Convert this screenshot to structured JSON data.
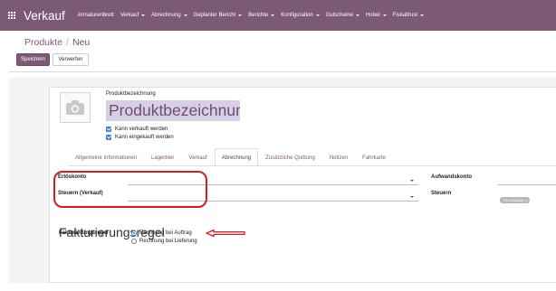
{
  "navbar": {
    "brand": "Verkauf",
    "menu": [
      {
        "label": "Armaturenbrett",
        "dropdown": false
      },
      {
        "label": "Verkauf",
        "dropdown": true
      },
      {
        "label": "Abrechnung",
        "dropdown": true
      },
      {
        "label": "Geplanter Bericht",
        "dropdown": true
      },
      {
        "label": "Berichte",
        "dropdown": true
      },
      {
        "label": "Konfiguration",
        "dropdown": true
      },
      {
        "label": "Gutscheine",
        "dropdown": true
      },
      {
        "label": "Hobel",
        "dropdown": true
      },
      {
        "label": "Fiskaltrust",
        "dropdown": true
      }
    ],
    "color": "#7c5a77"
  },
  "breadcrumb": {
    "parent": "Produkte",
    "separator": "/",
    "current": "Neu"
  },
  "buttons": {
    "save": "Speichern",
    "discard": "Verwerfen"
  },
  "product": {
    "name_label": "Produktbezeichnung",
    "name_placeholder": "Produktbezeichnung",
    "can_be_sold": "Kann verkauft werden",
    "can_be_purchased": "Kann eingekauft werden",
    "avatar_icon": "camera-icon"
  },
  "tabs": [
    {
      "label": "Allgemeine Informationen",
      "active": false
    },
    {
      "label": "Lagerbier",
      "active": false
    },
    {
      "label": "Verkauf",
      "active": false
    },
    {
      "label": "Abrechnung",
      "active": true
    },
    {
      "label": "Zusätzliche Quittung",
      "active": false
    },
    {
      "label": "Notizen",
      "active": false
    },
    {
      "label": "Fahrkarte",
      "active": false
    }
  ],
  "accounting": {
    "income_account_label": "Erlöskonto",
    "customer_taxes_label": "Steuern (Verkauf)",
    "expense_account_label": "Aufwandskonto",
    "vendor_taxes_label": "Steuern",
    "vendor_tax_tag": "7% Vorsteuer ×"
  },
  "invoicing": {
    "section_title": "Fakturierungsregel",
    "policy_label": "Fakturierungsregel",
    "options": [
      {
        "label": "Rechnung bei Auftrag",
        "checked": true
      },
      {
        "label": "Rechnung bei Lieferung",
        "checked": false
      }
    ]
  },
  "annotation_color": "#d61c1c"
}
